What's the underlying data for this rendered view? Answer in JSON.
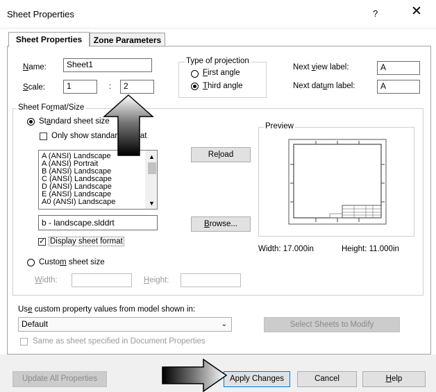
{
  "window": {
    "title": "Sheet Properties",
    "help": "?",
    "close": "✕"
  },
  "tabs": [
    {
      "label": "Sheet Properties"
    },
    {
      "label": "Zone Parameters"
    }
  ],
  "name": {
    "label": "Name:",
    "value": "Sheet1"
  },
  "scale": {
    "label": "Scale:",
    "num": "1",
    "sep": ":",
    "den": "2"
  },
  "projection": {
    "legend": "Type of projection",
    "first": "First angle",
    "third": "Third angle",
    "selected": "third"
  },
  "next_view_label": {
    "label": "Next view label:",
    "value": "A"
  },
  "next_datum_label": {
    "label": "Next datum label:",
    "value": "A"
  },
  "format": {
    "legend": "Sheet Format/Size",
    "standard_label": "Standard sheet size",
    "only_show_label": "Only show standard format",
    "items": [
      "A (ANSI) Landscape",
      "A (ANSI) Portrait",
      "B (ANSI) Landscape",
      "C (ANSI) Landscape",
      "D (ANSI) Landscape",
      "E (ANSI) Landscape",
      "A0 (ANSI) Landscape"
    ],
    "reload": "Reload",
    "file": "b - landscape.slddrt",
    "browse": "Browse...",
    "display_format": "Display sheet format",
    "custom_label": "Custom sheet size",
    "width_label": "Width:",
    "height_label": "Height:"
  },
  "preview": {
    "legend": "Preview",
    "width_text": "Width: 17.000in",
    "height_text": "Height: 11.000in"
  },
  "custom_props": {
    "label": "Use custom property values from model shown in:",
    "selected": "Default",
    "select_sheets": "Select Sheets to Modify",
    "same_as": "Same as sheet specified in Document Properties"
  },
  "footer": {
    "update_all": "Update All Properties",
    "apply": "Apply Changes",
    "cancel": "Cancel",
    "help": "Help"
  }
}
